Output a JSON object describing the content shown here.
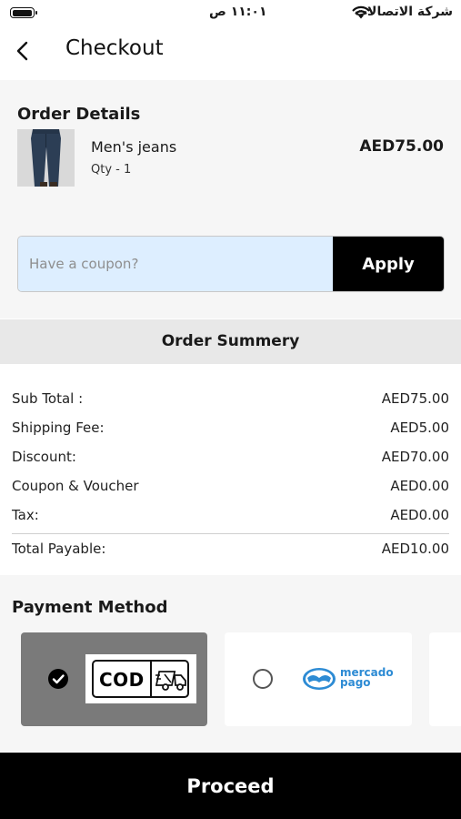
{
  "status_bar": {
    "time": "١١:٠١ ص",
    "carrier": "شركة الاتصالات",
    "battery_level": 1.0
  },
  "header": {
    "back_icon": "chevron-left-icon",
    "title": "Checkout"
  },
  "order_details": {
    "heading": "Order Details",
    "item": {
      "name": "Men's jeans",
      "qty": "Qty - 1",
      "price": "AED75.00",
      "image_icon": "jeans-product-image"
    },
    "coupon": {
      "placeholder": "Have a coupon?",
      "value": "",
      "apply_label": "Apply"
    }
  },
  "order_summary": {
    "heading": "Order Summery",
    "rows": [
      {
        "label": "Sub Total :",
        "value": "AED75.00"
      },
      {
        "label": "Shipping Fee:",
        "value": "AED5.00"
      },
      {
        "label": "Discount:",
        "value": "AED70.00"
      },
      {
        "label": "Coupon & Voucher",
        "value": "AED0.00"
      },
      {
        "label": "Tax:",
        "value": "AED0.00"
      }
    ],
    "total": {
      "label": "Total Payable:",
      "value": "AED10.00"
    }
  },
  "payment": {
    "heading": "Payment Method",
    "options": [
      {
        "logo_text": "COD",
        "selected": true,
        "icon": "delivery-truck-icon"
      },
      {
        "logo_text_1": "mercado",
        "logo_text_2": "pago",
        "selected": false,
        "icon": "mercado-pago-logo"
      }
    ]
  },
  "footer": {
    "proceed_label": "Proceed"
  },
  "colors": {
    "primary": "#000000",
    "coupon_bg": "#ddeeff",
    "selected_card": "#7a7a7a",
    "mercado_blue": "#2d8bd4"
  }
}
